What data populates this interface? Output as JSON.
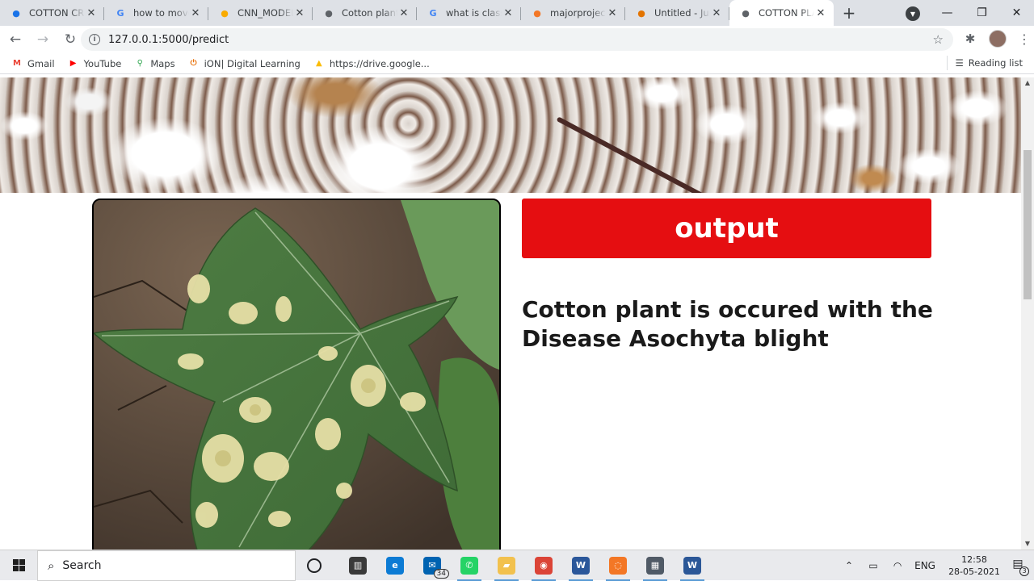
{
  "browser": {
    "tabs": [
      {
        "title": "COTTON CROP",
        "icon": "google-drive-icon",
        "color": "#1a73e8",
        "active": false
      },
      {
        "title": "how to move",
        "icon": "google-icon",
        "color": "#4285f4",
        "active": false
      },
      {
        "title": "CNN_MODEL",
        "icon": "colab-icon",
        "color": "#f9ab00",
        "active": false
      },
      {
        "title": "Cotton plant",
        "icon": "globe-icon",
        "color": "#5f6368",
        "active": false
      },
      {
        "title": "what is classif",
        "icon": "google-icon",
        "color": "#4285f4",
        "active": false
      },
      {
        "title": "majorproject/",
        "icon": "jupyter-icon",
        "color": "#f37726",
        "active": false
      },
      {
        "title": "Untitled - Jup",
        "icon": "hourglass-icon",
        "color": "#e37400",
        "active": false
      },
      {
        "title": "COTTON PLANT",
        "icon": "globe-icon",
        "color": "#5f6368",
        "active": true
      }
    ],
    "address": "127.0.0.1:5000/predict",
    "bookmarks": [
      {
        "label": "Gmail",
        "icon": "gmail-icon",
        "color": "#ea4335"
      },
      {
        "label": "YouTube",
        "icon": "youtube-icon",
        "color": "#ff0000"
      },
      {
        "label": "Maps",
        "icon": "maps-icon",
        "color": "#34a853"
      },
      {
        "label": "iON| Digital Learning",
        "icon": "ion-icon",
        "color": "#e8710a"
      },
      {
        "label": "https://drive.google...",
        "icon": "google-drive-icon",
        "color": "#fbbc04"
      }
    ],
    "reading_list": "Reading list"
  },
  "page": {
    "output_label": "output",
    "result_text": "Cotton plant is occured with the Disease Asochyta blight",
    "accent": "#e50e11"
  },
  "taskbar": {
    "search_placeholder": "Search",
    "mail_badge": "34",
    "language": "ENG",
    "time": "12:58",
    "date": "28-05-2021",
    "notification_count": "3",
    "apps": [
      {
        "name": "task-view-icon",
        "color": "#3a3a3a"
      },
      {
        "name": "edge-icon",
        "color": "#0c7bd4"
      },
      {
        "name": "mail-icon",
        "color": "#0063b1"
      },
      {
        "name": "whatsapp-icon",
        "color": "#25d366"
      },
      {
        "name": "file-explorer-icon",
        "color": "#f2c14e"
      },
      {
        "name": "chrome-icon",
        "color": "#db4437"
      },
      {
        "name": "word-app-icon",
        "color": "#2b579a"
      },
      {
        "name": "jupyter-app-icon",
        "color": "#f37726"
      },
      {
        "name": "calculator-icon",
        "color": "#505a66"
      },
      {
        "name": "ms-word-icon",
        "color": "#2b5797"
      }
    ]
  }
}
